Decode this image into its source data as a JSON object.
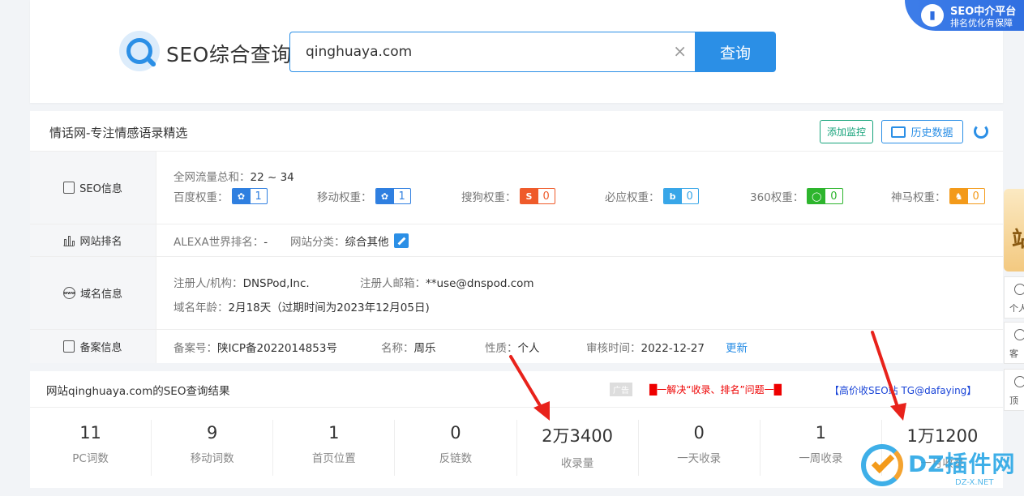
{
  "header": {
    "title": "SEO综合查询",
    "search_value": "qinghuaya.com",
    "search_button": "查询",
    "clear_glyph": "×",
    "promo_line1": "SEO中介平台",
    "promo_line2": "排名优化有保障"
  },
  "site": {
    "name": "情话网-专注情感语录精选",
    "monitor_button": "添加监控",
    "history_button": "历史数据"
  },
  "seo_info": {
    "label": "SEO信息",
    "traffic_label": "全网流量总和：",
    "traffic_value": "22 ~ 34",
    "weights": [
      {
        "label": "百度权重：",
        "value": "1",
        "icon": "baidu-paw"
      },
      {
        "label": "移动权重：",
        "value": "1",
        "icon": "baidu-paw"
      },
      {
        "label": "搜狗权重：",
        "value": "0",
        "icon": "sogou-s"
      },
      {
        "label": "必应权重：",
        "value": "0",
        "icon": "bing-b"
      },
      {
        "label": "360权重：",
        "value": "0",
        "icon": "360-ring"
      },
      {
        "label": "神马权重：",
        "value": "0",
        "icon": "shenma-horse"
      }
    ]
  },
  "rank_info": {
    "label": "网站排名",
    "alexa_label": "ALEXA世界排名：",
    "alexa_value": "-",
    "category_label": "网站分类：",
    "category_value": "综合其他"
  },
  "domain_info": {
    "label": "域名信息",
    "registrant_label": "注册人/机构：",
    "registrant_value": "DNSPod,Inc.",
    "email_label": "注册人邮箱：",
    "email_value": "**use@dnspod.com",
    "age_label": "域名年龄：",
    "age_value": "2月18天（过期时间为2023年12月05日)"
  },
  "icp_info": {
    "label": "备案信息",
    "number_label": "备案号：",
    "number_value": "陕ICP备2022014853号",
    "name_label": "名称：",
    "name_value": "周乐",
    "type_label": "性质：",
    "type_value": "个人",
    "audit_label": "审核时间：",
    "audit_value": "2022-12-27",
    "update_link": "更新"
  },
  "results": {
    "title": "网站qinghuaya.com的SEO查询结果",
    "ad_tag": "广告",
    "ad_text1": "█一解决“收录、排名”问题一█",
    "ad_text2": "【高价收SEO站 TG@dafaying】",
    "stats": [
      {
        "value": "11",
        "label": "PC词数"
      },
      {
        "value": "9",
        "label": "移动词数"
      },
      {
        "value": "1",
        "label": "首页位置"
      },
      {
        "value": "0",
        "label": "反链数"
      },
      {
        "value": "2万3400",
        "label": "收录量"
      },
      {
        "value": "0",
        "label": "一天收录"
      },
      {
        "value": "1",
        "label": "一周收录"
      },
      {
        "value": "1万1200",
        "label": "一月收录"
      }
    ]
  },
  "side_float": {
    "ad_char": "站",
    "item1": "个人",
    "item2": "客",
    "item3": "顶"
  },
  "watermark": {
    "text": "DZ插件网",
    "url": "DZ-X.NET"
  },
  "colors": {
    "primary": "#2b8fe6",
    "green": "#16a37b",
    "arrow": "#e8221b"
  }
}
